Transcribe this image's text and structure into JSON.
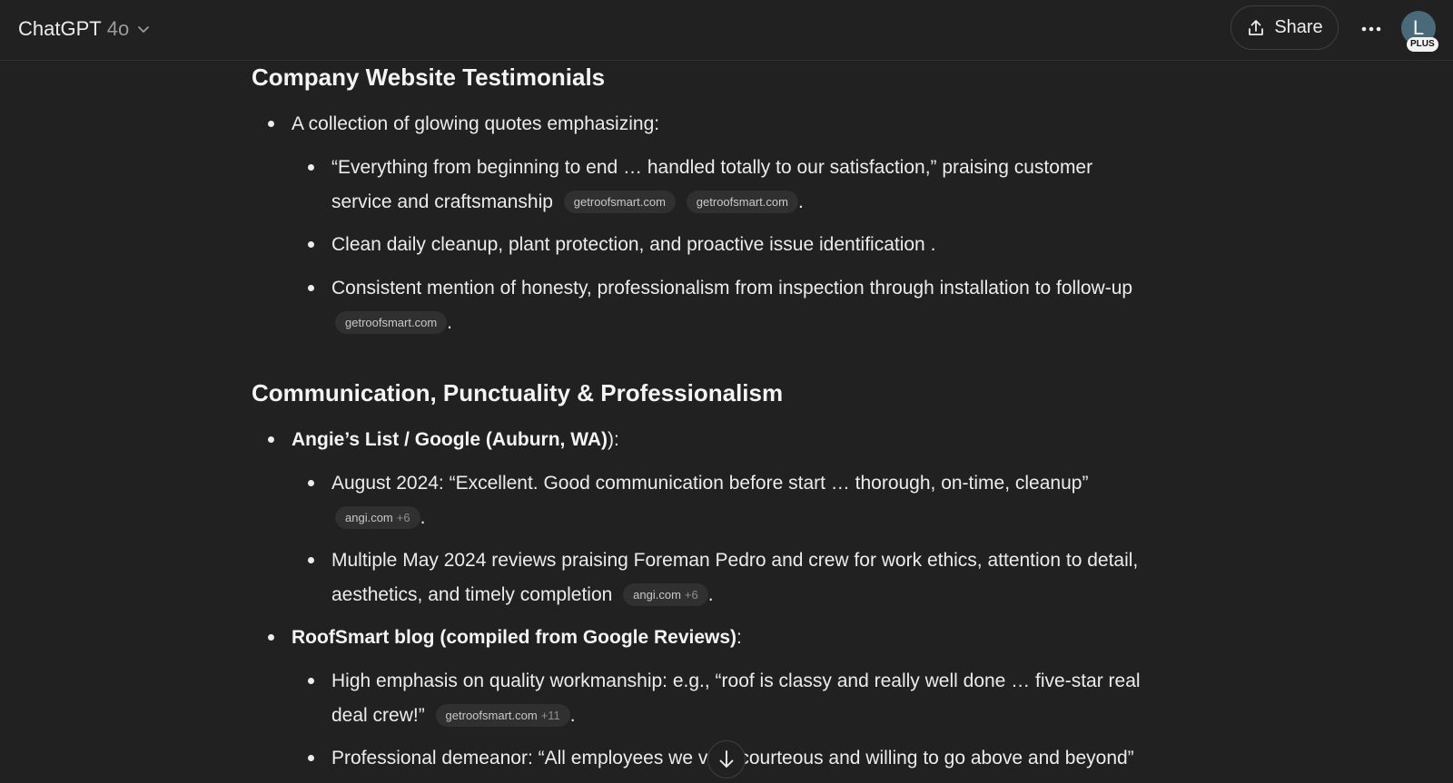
{
  "header": {
    "app_name": "ChatGPT",
    "model_version": "4o",
    "share_label": "Share",
    "avatar_initial": "L",
    "plan_badge": "PLUS"
  },
  "sections": [
    {
      "title": "Company Website Testimonials",
      "items": [
        {
          "text": "A collection of glowing quotes emphasizing:",
          "children": [
            {
              "line1": "“Everything from beginning to end … handled totally to our satisfaction,” praising customer",
              "line2": "service and craftsmanship",
              "chips": [
                {
                  "label": "getroofsmart.com"
                },
                {
                  "label": "getroofsmart.com"
                }
              ],
              "end": "."
            },
            {
              "line1": "Clean daily cleanup, plant protection, and proactive issue identification ."
            },
            {
              "line1": "Consistent mention of honesty, professionalism from inspection through installation to follow-up",
              "chips": [
                {
                  "label": "getroofsmart.com"
                }
              ],
              "end": "."
            }
          ]
        }
      ]
    },
    {
      "title": "Communication, Punctuality & Professionalism",
      "items": [
        {
          "bold": "Angie’s List / Google (Auburn, WA)",
          "suffix": "):",
          "children": [
            {
              "line1": "August 2024: “Excellent. Good communication before start … thorough, on-time, cleanup”",
              "chips": [
                {
                  "label": "angi.com",
                  "extra": "+6"
                }
              ],
              "end": "."
            },
            {
              "line1": "Multiple May 2024 reviews praising Foreman Pedro and crew for work ethics, attention to detail,",
              "line2": "aesthetics, and timely completion",
              "chips": [
                {
                  "label": "angi.com",
                  "extra": "+6"
                }
              ],
              "end": "."
            }
          ]
        },
        {
          "bold": "RoofSmart blog (compiled from Google Reviews)",
          "suffix": ":",
          "children": [
            {
              "line1": "High emphasis on quality workmanship: e.g., “roof is classy and really well done … five-star real",
              "line2": "deal crew!”",
              "chips": [
                {
                  "label": "getroofsmart.com",
                  "extra": "+11"
                }
              ],
              "end": "."
            },
            {
              "line1": "Professional demeanor: “All employees we very courteous and willing to go above and beyond”"
            }
          ]
        }
      ]
    }
  ]
}
